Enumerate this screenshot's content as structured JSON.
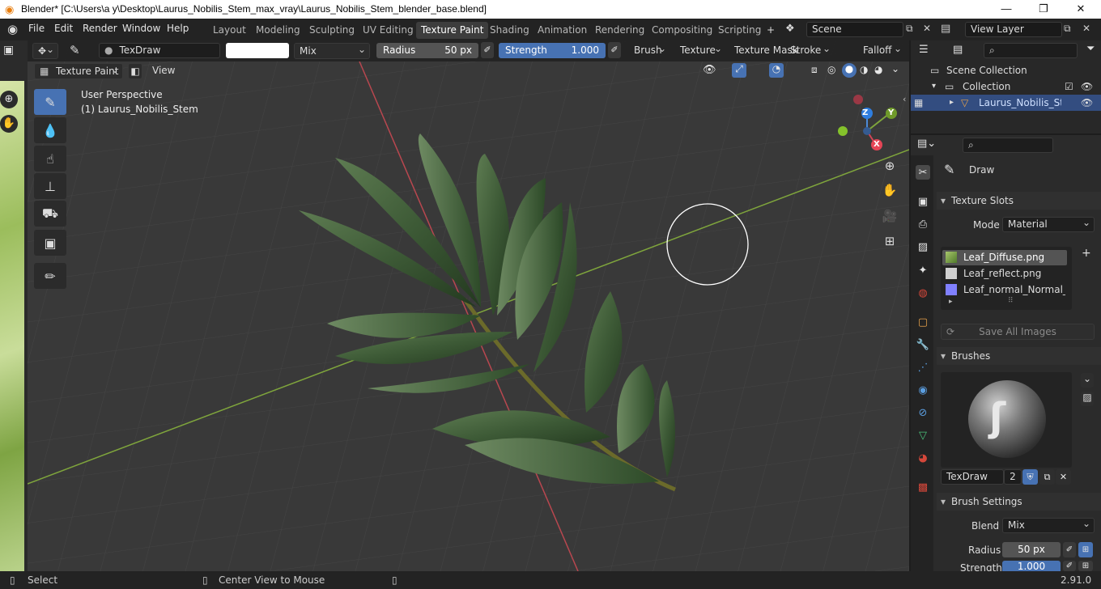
{
  "window": {
    "title": "Blender* [C:\\Users\\a y\\Desktop\\Laurus_Nobilis_Stem_max_vray\\Laurus_Nobilis_Stem_blender_base.blend]",
    "minimize": "—",
    "maximize": "❐",
    "close": "✕"
  },
  "menu": {
    "items": [
      "File",
      "Edit",
      "Render",
      "Window",
      "Help"
    ],
    "workspaces": [
      "Layout",
      "Modeling",
      "Sculpting",
      "UV Editing",
      "Texture Paint",
      "Shading",
      "Animation",
      "Rendering",
      "Compositing",
      "Scripting"
    ],
    "active_workspace": "Texture Paint",
    "add_workspace": "+",
    "scene": "Scene",
    "view_layer": "View Layer"
  },
  "toolheader": {
    "brush_name": "TexDraw",
    "blend": "Mix",
    "radius_label": "Radius",
    "radius_value": "50 px",
    "strength_label": "Strength",
    "strength_value": "1.000",
    "menus": [
      "Brush",
      "Texture",
      "Texture Mask",
      "Stroke",
      "Falloff"
    ]
  },
  "viewport_header": {
    "mode": "Texture Paint",
    "view": "View"
  },
  "viewport": {
    "perspective": "User Perspective",
    "object": "(1) Laurus_Nobilis_Stem",
    "gizmo": {
      "z": "Z",
      "y": "Y",
      "x": "X"
    },
    "grid_color": "#4a4a4a",
    "x_axis_color": "#b8474f",
    "y_axis_color": "#7fa53c"
  },
  "outliner": {
    "scene_collection": "Scene Collection",
    "collection": "Collection",
    "object": "Laurus_Nobilis_Stem"
  },
  "properties": {
    "tool_name": "Draw",
    "texture_slots": {
      "title": "Texture Slots",
      "mode_label": "Mode",
      "mode_value": "Material",
      "items": [
        "Leaf_Diffuse.png",
        "Leaf_reflect.png",
        "Leaf_normal_Normal_B..."
      ],
      "save_all": "Save All Images"
    },
    "brushes": {
      "title": "Brushes",
      "brush_name": "TexDraw",
      "users": "2"
    },
    "brush_settings": {
      "title": "Brush Settings",
      "blend_label": "Blend",
      "blend_value": "Mix",
      "radius_label": "Radius",
      "radius_value": "50 px",
      "strength_label": "Strength",
      "strength_value": "1.000"
    }
  },
  "statusbar": {
    "select": "Select",
    "center": "Center View to Mouse",
    "version": "2.91.0"
  },
  "colors": {
    "accent": "#4772b3",
    "active_highlight": "#334d80"
  }
}
